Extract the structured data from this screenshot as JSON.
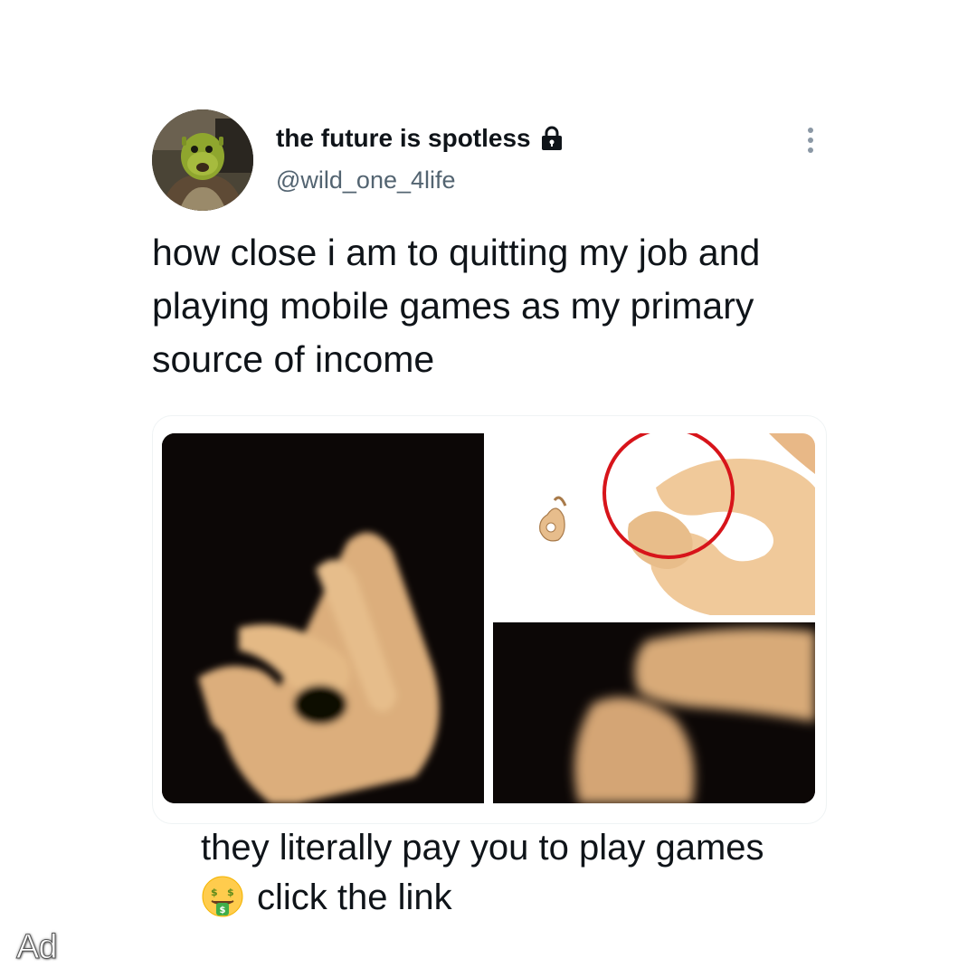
{
  "tweet": {
    "display_name": "the future is spotless",
    "handle": "@wild_one_4life",
    "text": "how close i am to quitting my job and playing mobile games as my primary source of income",
    "avatar_icon": "avatar-image",
    "protected_icon": "lock-icon",
    "more_icon": "more-options-icon"
  },
  "media": {
    "images": [
      {
        "description_icon": "ok-hand-gesture-image"
      },
      {
        "description_icon": "ok-hand-emoji-circled-image"
      },
      {
        "description_icon": "ok-hand-zoom-image"
      }
    ]
  },
  "caption": {
    "line1": "they literally pay you to play games",
    "line2": "click the link",
    "emoji_icon": "money-mouth-face-icon"
  },
  "ad_label": "Ad",
  "colors": {
    "text_primary": "#0f1419",
    "text_secondary": "#536471",
    "skin": "#e7bd8c",
    "circle_red": "#d7141a",
    "panel_dark": "#0c0706"
  }
}
